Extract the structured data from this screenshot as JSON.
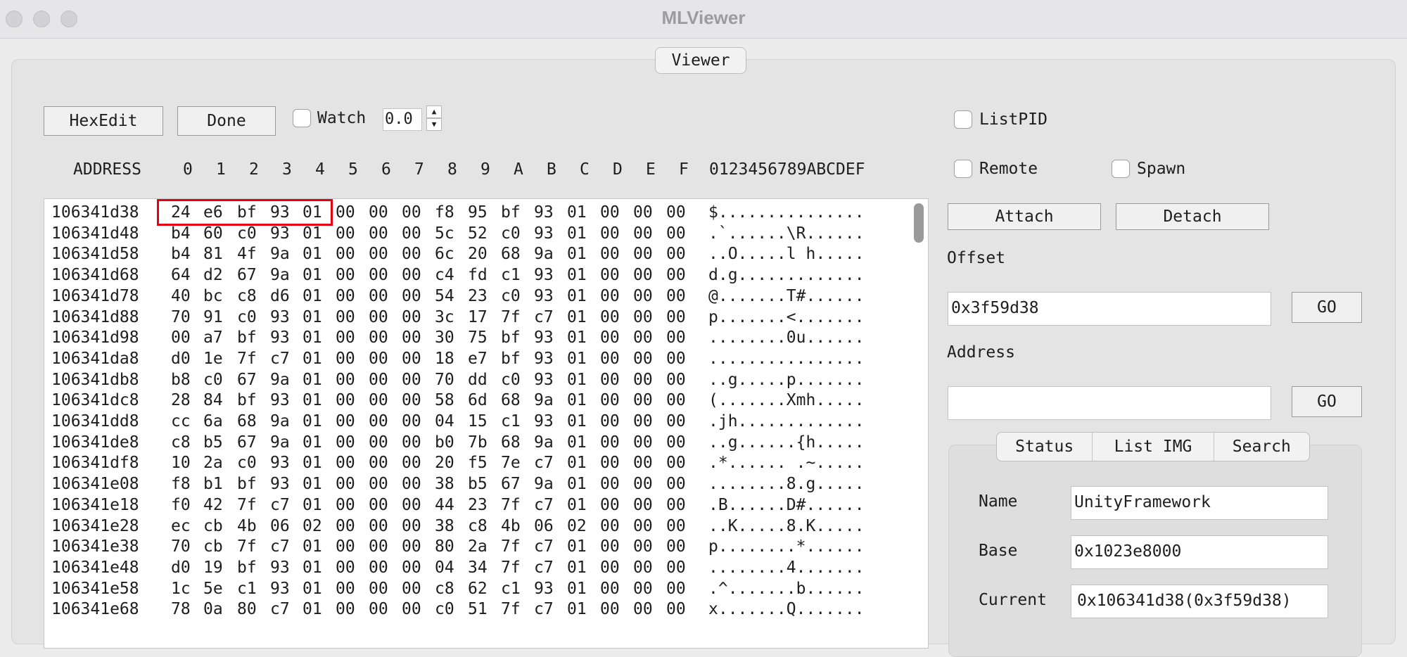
{
  "window": {
    "title": "MLViewer"
  },
  "viewer_tab": "Viewer",
  "toolbar": {
    "hexedit_label": "HexEdit",
    "done_label": "Done",
    "watch_label": "Watch",
    "watch_value": "0.0"
  },
  "right": {
    "listpid_label": "ListPID",
    "remote_label": "Remote",
    "spawn_label": "Spawn",
    "attach_label": "Attach",
    "detach_label": "Detach",
    "offset_label": "Offset",
    "offset_value": "0x3f59d38",
    "go_label": "GO",
    "address_label": "Address",
    "address_value": ""
  },
  "tabs": [
    "Status",
    "List IMG",
    "Search"
  ],
  "status": {
    "name_label": "Name",
    "name_value": "UnityFramework",
    "base_label": "Base",
    "base_value": "0x1023e8000",
    "current_label": "Current",
    "current_value": "0x106341d38(0x3f59d38)"
  },
  "hex_header": {
    "address": "ADDRESS",
    "columns": [
      "0",
      "1",
      "2",
      "3",
      "4",
      "5",
      "6",
      "7",
      "8",
      "9",
      "A",
      "B",
      "C",
      "D",
      "E",
      "F"
    ],
    "ascii": "0123456789ABCDEF"
  },
  "hex_rows": [
    {
      "address": "106341d38",
      "bytes": [
        "24",
        "e6",
        "bf",
        "93",
        "01",
        "00",
        "00",
        "00",
        "f8",
        "95",
        "bf",
        "93",
        "01",
        "00",
        "00",
        "00"
      ],
      "ascii": "$..............."
    },
    {
      "address": "106341d48",
      "bytes": [
        "b4",
        "60",
        "c0",
        "93",
        "01",
        "00",
        "00",
        "00",
        "5c",
        "52",
        "c0",
        "93",
        "01",
        "00",
        "00",
        "00"
      ],
      "ascii": ".`......\\R......"
    },
    {
      "address": "106341d58",
      "bytes": [
        "b4",
        "81",
        "4f",
        "9a",
        "01",
        "00",
        "00",
        "00",
        "6c",
        "20",
        "68",
        "9a",
        "01",
        "00",
        "00",
        "00"
      ],
      "ascii": "..O.....l h....."
    },
    {
      "address": "106341d68",
      "bytes": [
        "64",
        "d2",
        "67",
        "9a",
        "01",
        "00",
        "00",
        "00",
        "c4",
        "fd",
        "c1",
        "93",
        "01",
        "00",
        "00",
        "00"
      ],
      "ascii": "d.g............."
    },
    {
      "address": "106341d78",
      "bytes": [
        "40",
        "bc",
        "c8",
        "d6",
        "01",
        "00",
        "00",
        "00",
        "54",
        "23",
        "c0",
        "93",
        "01",
        "00",
        "00",
        "00"
      ],
      "ascii": "@.......T#......"
    },
    {
      "address": "106341d88",
      "bytes": [
        "70",
        "91",
        "c0",
        "93",
        "01",
        "00",
        "00",
        "00",
        "3c",
        "17",
        "7f",
        "c7",
        "01",
        "00",
        "00",
        "00"
      ],
      "ascii": "p.......<......."
    },
    {
      "address": "106341d98",
      "bytes": [
        "00",
        "a7",
        "bf",
        "93",
        "01",
        "00",
        "00",
        "00",
        "30",
        "75",
        "bf",
        "93",
        "01",
        "00",
        "00",
        "00"
      ],
      "ascii": "........0u......"
    },
    {
      "address": "106341da8",
      "bytes": [
        "d0",
        "1e",
        "7f",
        "c7",
        "01",
        "00",
        "00",
        "00",
        "18",
        "e7",
        "bf",
        "93",
        "01",
        "00",
        "00",
        "00"
      ],
      "ascii": "................"
    },
    {
      "address": "106341db8",
      "bytes": [
        "b8",
        "c0",
        "67",
        "9a",
        "01",
        "00",
        "00",
        "00",
        "70",
        "dd",
        "c0",
        "93",
        "01",
        "00",
        "00",
        "00"
      ],
      "ascii": "..g.....p......."
    },
    {
      "address": "106341dc8",
      "bytes": [
        "28",
        "84",
        "bf",
        "93",
        "01",
        "00",
        "00",
        "00",
        "58",
        "6d",
        "68",
        "9a",
        "01",
        "00",
        "00",
        "00"
      ],
      "ascii": "(.......Xmh....."
    },
    {
      "address": "106341dd8",
      "bytes": [
        "cc",
        "6a",
        "68",
        "9a",
        "01",
        "00",
        "00",
        "00",
        "04",
        "15",
        "c1",
        "93",
        "01",
        "00",
        "00",
        "00"
      ],
      "ascii": ".jh............."
    },
    {
      "address": "106341de8",
      "bytes": [
        "c8",
        "b5",
        "67",
        "9a",
        "01",
        "00",
        "00",
        "00",
        "b0",
        "7b",
        "68",
        "9a",
        "01",
        "00",
        "00",
        "00"
      ],
      "ascii": "..g......{h....."
    },
    {
      "address": "106341df8",
      "bytes": [
        "10",
        "2a",
        "c0",
        "93",
        "01",
        "00",
        "00",
        "00",
        "20",
        "f5",
        "7e",
        "c7",
        "01",
        "00",
        "00",
        "00"
      ],
      "ascii": ".*...... .~....."
    },
    {
      "address": "106341e08",
      "bytes": [
        "f8",
        "b1",
        "bf",
        "93",
        "01",
        "00",
        "00",
        "00",
        "38",
        "b5",
        "67",
        "9a",
        "01",
        "00",
        "00",
        "00"
      ],
      "ascii": "........8.g....."
    },
    {
      "address": "106341e18",
      "bytes": [
        "f0",
        "42",
        "7f",
        "c7",
        "01",
        "00",
        "00",
        "00",
        "44",
        "23",
        "7f",
        "c7",
        "01",
        "00",
        "00",
        "00"
      ],
      "ascii": ".B......D#......"
    },
    {
      "address": "106341e28",
      "bytes": [
        "ec",
        "cb",
        "4b",
        "06",
        "02",
        "00",
        "00",
        "00",
        "38",
        "c8",
        "4b",
        "06",
        "02",
        "00",
        "00",
        "00"
      ],
      "ascii": "..K.....8.K....."
    },
    {
      "address": "106341e38",
      "bytes": [
        "70",
        "cb",
        "7f",
        "c7",
        "01",
        "00",
        "00",
        "00",
        "80",
        "2a",
        "7f",
        "c7",
        "01",
        "00",
        "00",
        "00"
      ],
      "ascii": "p........*......"
    },
    {
      "address": "106341e48",
      "bytes": [
        "d0",
        "19",
        "bf",
        "93",
        "01",
        "00",
        "00",
        "00",
        "04",
        "34",
        "7f",
        "c7",
        "01",
        "00",
        "00",
        "00"
      ],
      "ascii": "........4......."
    },
    {
      "address": "106341e58",
      "bytes": [
        "1c",
        "5e",
        "c1",
        "93",
        "01",
        "00",
        "00",
        "00",
        "c8",
        "62",
        "c1",
        "93",
        "01",
        "00",
        "00",
        "00"
      ],
      "ascii": ".^.......b......"
    },
    {
      "address": "106341e68",
      "bytes": [
        "78",
        "0a",
        "80",
        "c7",
        "01",
        "00",
        "00",
        "00",
        "c0",
        "51",
        "7f",
        "c7",
        "01",
        "00",
        "00",
        "00"
      ],
      "ascii": "x.......Q......."
    }
  ]
}
